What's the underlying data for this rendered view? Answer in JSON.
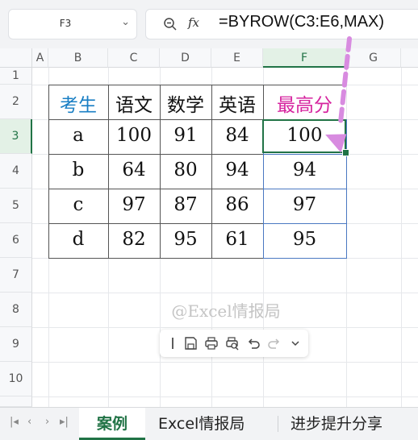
{
  "formula_bar": {
    "name_box": "F3",
    "fx_label": "fx",
    "formula": "=BYROW(C3:E6,MAX)"
  },
  "column_headers": [
    "A",
    "B",
    "C",
    "D",
    "E",
    "F",
    "G"
  ],
  "row_headers": [
    "1",
    "2",
    "3",
    "4",
    "5",
    "6",
    "7",
    "8",
    "9",
    "10"
  ],
  "table": {
    "headers": [
      "考生",
      "语文",
      "数学",
      "英语",
      "最高分"
    ],
    "rows": [
      [
        "a",
        "100",
        "91",
        "84",
        "100"
      ],
      [
        "b",
        "64",
        "80",
        "94",
        "94"
      ],
      [
        "c",
        "97",
        "87",
        "86",
        "97"
      ],
      [
        "d",
        "82",
        "95",
        "61",
        "95"
      ]
    ]
  },
  "active_cell": "F3",
  "watermark": "@Excel情报局",
  "sheet_tabs": [
    "案例",
    "Excel情报局",
    "进步提升分享"
  ],
  "active_tab": "案例",
  "colors": {
    "accent_green": "#217346",
    "header_blue": "#1a7fc4",
    "header_pink": "#d6249f",
    "arrow_violet": "#d88be0"
  },
  "icons": {
    "name_box_dropdown": "chevron-down-icon",
    "zoom": "zoom-out-icon",
    "toolbar": [
      "text-cursor-icon",
      "save-icon",
      "print-icon",
      "print-preview-icon",
      "undo-icon",
      "redo-icon",
      "chevron-down-icon"
    ]
  }
}
